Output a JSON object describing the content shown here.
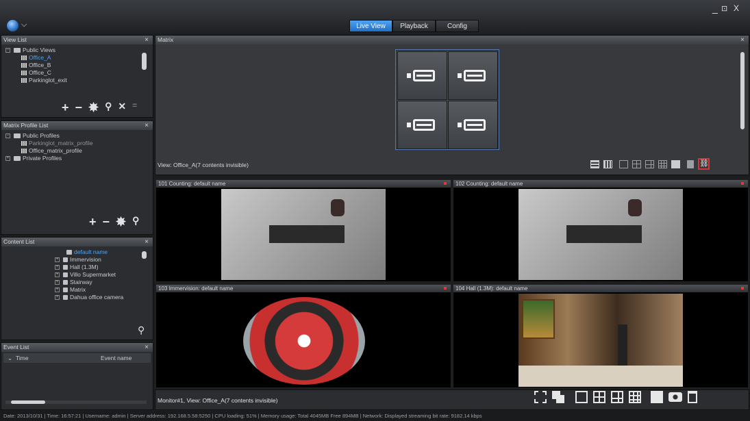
{
  "window": {
    "minimize": "_",
    "restore": "⊡",
    "close": "X"
  },
  "tabs": [
    {
      "label": "Live View",
      "active": true
    },
    {
      "label": "Playback",
      "active": false
    },
    {
      "label": "Config",
      "active": false
    }
  ],
  "view_list": {
    "title": "View List",
    "close": "×",
    "items": [
      {
        "label": "Public Views",
        "level": 0
      },
      {
        "label": "Office_A",
        "level": 1,
        "selected": true
      },
      {
        "label": "Office_B",
        "level": 1
      },
      {
        "label": "Office_C",
        "level": 1
      },
      {
        "label": "Parkinglot_exit",
        "level": 1
      }
    ],
    "tools": [
      "+",
      "−",
      "✸",
      "⚲",
      "✕",
      "="
    ]
  },
  "matrix_profile_list": {
    "title": "Matrix Profile List",
    "close": "×",
    "items": [
      {
        "label": "Public Profiles",
        "level": 0
      },
      {
        "label": "Parkinglot_matrix_profile",
        "level": 1
      },
      {
        "label": "Office_matrix_profile",
        "level": 1
      },
      {
        "label": "Private Profiles",
        "level": 0
      }
    ],
    "tools": [
      "+",
      "−",
      "✸",
      "⚲"
    ]
  },
  "content_list": {
    "title": "Content List",
    "close": "×",
    "items": [
      {
        "label": "default name",
        "sel": true
      },
      {
        "label": "Immervision"
      },
      {
        "label": "Hall (1.3M)"
      },
      {
        "label": "Villo Supermarket"
      },
      {
        "label": "Stairway"
      },
      {
        "label": "Matrix"
      },
      {
        "label": "Dahua office camera"
      }
    ],
    "search": "⚲"
  },
  "event_list": {
    "title": "Event List",
    "close": "×",
    "col_time": "Time",
    "col_event": "Event name"
  },
  "matrix": {
    "title": "Matrix",
    "close": "×",
    "view_label": "View: Office_A(7 contents invisible)"
  },
  "videos": [
    {
      "title": "101 Counting: default name"
    },
    {
      "title": "102 Counting: default name"
    },
    {
      "title": "103 Immervision: default name"
    },
    {
      "title": "104 Hall (1.3M): default name"
    }
  ],
  "monitor_label": "Monitor#1, View: Office_A(7 contents invisible)",
  "status_bar": "Date: 2013/10/31  |  Time: 16:57:21  |  Username: admin  |  Server address: 192.168.5.58:5250  |  CPU loading: 51%  |  Memory usage: Total 4045MB Free 894MB  |  Network: Displayed streaming bit rate: 9182.14 kbps"
}
